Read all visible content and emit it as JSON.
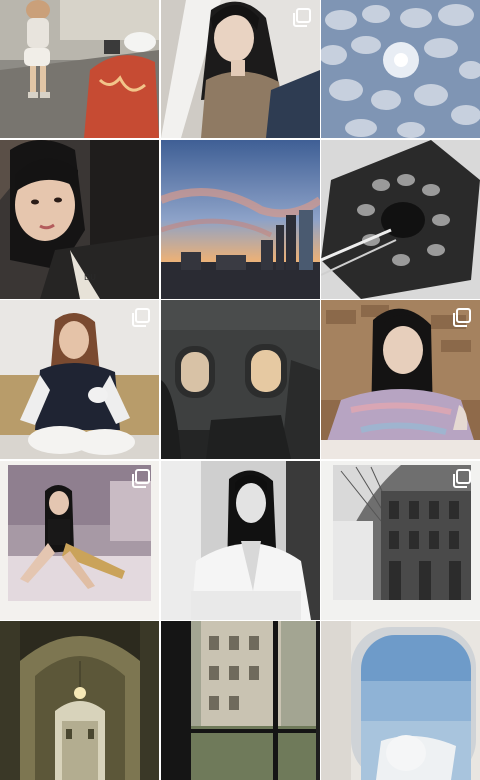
{
  "app": "photo-grid",
  "colors": {
    "background": "#ffffff",
    "multi_icon": "#ffffff"
  },
  "posts": [
    {
      "id": "p1",
      "subject": "street-child-and-photographer",
      "multi": false
    },
    {
      "id": "p2",
      "subject": "woman-portrait-window-light",
      "multi": true
    },
    {
      "id": "p3",
      "subject": "cloudy-sky-sun",
      "multi": false
    },
    {
      "id": "p4",
      "subject": "woman-selfie-close-up",
      "multi": false
    },
    {
      "id": "p5",
      "subject": "city-skyline-sunset",
      "multi": false
    },
    {
      "id": "p6",
      "subject": "bw-spiral-staircase",
      "multi": false
    },
    {
      "id": "p7",
      "subject": "woman-in-varsity-jacket-sitting",
      "multi": true
    },
    {
      "id": "p8",
      "subject": "airplane-cabin-windows",
      "multi": false
    },
    {
      "id": "p9",
      "subject": "woman-in-knit-sweater-with-wine",
      "multi": true
    },
    {
      "id": "p10",
      "subject": "polaroid-woman-on-bed",
      "multi": true
    },
    {
      "id": "p11",
      "subject": "bw-woman-in-bathrobe",
      "multi": false
    },
    {
      "id": "p12",
      "subject": "polaroid-galleria-arcade",
      "multi": true
    },
    {
      "id": "p13",
      "subject": "arched-corridor-lamp",
      "multi": false
    },
    {
      "id": "p14",
      "subject": "window-view-building",
      "multi": false
    },
    {
      "id": "p15",
      "subject": "airplane-window-wing",
      "multi": false
    }
  ]
}
